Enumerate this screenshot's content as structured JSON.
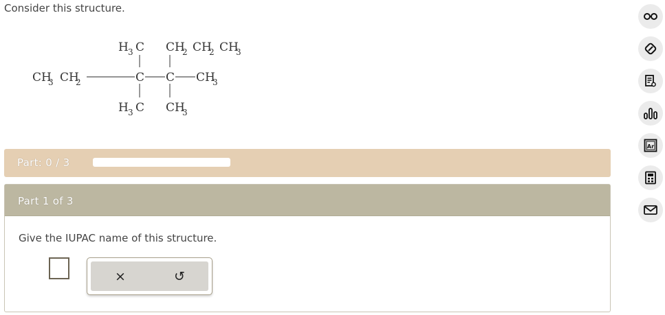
{
  "prompt": "Consider this structure.",
  "structure": {
    "left_group": "CH",
    "left_group_sub": "3",
    "left_group_2": "CH",
    "left_group_2_sub": "2",
    "carbon_a": "C",
    "carbon_b": "C",
    "a_top": "H",
    "a_top_sub": "3",
    "a_top_c": "C",
    "a_bottom": "H",
    "a_bottom_sub": "3",
    "a_bottom_c": "C",
    "b_top_1": "CH",
    "b_top_1_sub": "2",
    "b_top_2": "CH",
    "b_top_2_sub": "2",
    "b_top_3": "CH",
    "b_top_3_sub": "3",
    "b_right": "CH",
    "b_right_sub": "3",
    "b_bottom": "CH",
    "b_bottom_sub": "3"
  },
  "progress": {
    "label": "Part: 0 / 3",
    "completed_fraction": 0
  },
  "part": {
    "title": "Part 1 of 3",
    "question": "Give the IUPAC name of this structure."
  },
  "actions": {
    "clear_symbol": "×",
    "undo_symbol": "↺"
  },
  "toolbar": {
    "icons": [
      "glasses-icon",
      "eraser-icon",
      "notes-icon",
      "chart-icon",
      "periodic-table-icon",
      "calculator-icon",
      "mail-icon"
    ],
    "periodic_label": "Ar"
  },
  "colors": {
    "progress_bg": "#e5cfb3",
    "header_bg": "#bcb7a1",
    "toolbar_bg": "#ebebeb"
  }
}
